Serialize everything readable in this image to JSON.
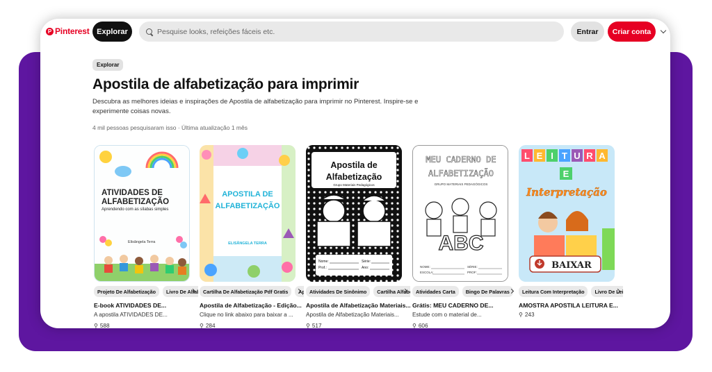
{
  "header": {
    "logo_label": "Pinterest",
    "explore_label": "Explorar",
    "search_placeholder": "Pesquise looks, refeições fáceis etc.",
    "login_label": "Entrar",
    "signup_label": "Criar conta"
  },
  "breadcrumb": "Explorar",
  "page_title": "Apostila de alfabetização para imprimir",
  "description": "Descubra as melhores ideias e inspirações de Apostila de alfabetização para imprimir no Pinterest. Inspire-se e experimente coisas novas.",
  "meta": "4 mil pessoas pesquisaram isso · Última atualização 1 mês",
  "colors": {
    "brand": "#e60023",
    "frame": "#5e16a0"
  },
  "cards": [
    {
      "chips": [
        "Projeto De Alfabetização",
        "Livro De Alfabetização"
      ],
      "title": "E-book ATIVIDADES DE...",
      "subtitle": "A apostila ATIVIDADES DE...",
      "count": "588",
      "thumb": {
        "line1": "ATIVIDADES DE",
        "line2": "ALFABETIZAÇÃO",
        "line3": "Aprendendo com as sílabas simples",
        "author": "Elisângela Terra"
      }
    },
    {
      "chips": [
        "Cartilha De Alfabetização Pdf Gratis",
        "Apostila"
      ],
      "title": "Apostila de Alfabetização - Edição...",
      "subtitle": "Clique no link abaixo para baixar a ...",
      "count": "284",
      "thumb": {
        "line1": "APOSTILA DE",
        "line2": "ALFABETIZAÇÃO",
        "author": "ELISÂNGELA TERRA"
      }
    },
    {
      "chips": [
        "Atividades De Sinônimo",
        "Cartilha Alfabetização"
      ],
      "title": "Apostila de Alfabetização Materiais...",
      "subtitle": "Apostila de Alfabetização Materiais...",
      "count": "517",
      "thumb": {
        "line1": "Apostila de",
        "line2": "Alfabetização",
        "line3": "Grupo Materiais Pedagógicos",
        "field1": "Nome:",
        "field2": "Série:",
        "field3": "Prof.:",
        "field4": "Ano:"
      }
    },
    {
      "chips": [
        "Atividades Carta",
        "Bingo De Palavras"
      ],
      "title": "Grátis: MEU CADERNO DE...",
      "subtitle": "Estude com o material de...",
      "count": "606",
      "thumb": {
        "line1": "MEU CADERNO DE",
        "line2": "ALFABETIZAÇÃO",
        "line3": "GRUPO MATERIAIS PEDAGÓGICOS",
        "letters": "ABC",
        "field1": "NOME:",
        "field2": "SÉRIE:",
        "field3": "ESCOLA:",
        "field4": "PROF:"
      }
    },
    {
      "chips": [
        "Leitura Com Interpretação",
        "Livro De Leitura"
      ],
      "title": "AMOSTRA APOSTILA LEITURA E...",
      "subtitle": "",
      "count": "243",
      "thumb": {
        "letters": [
          "L",
          "E",
          "I",
          "T",
          "U",
          "R",
          "A"
        ],
        "line2": "E",
        "line3": "Interpretação",
        "button": "BAIXAR"
      }
    }
  ]
}
